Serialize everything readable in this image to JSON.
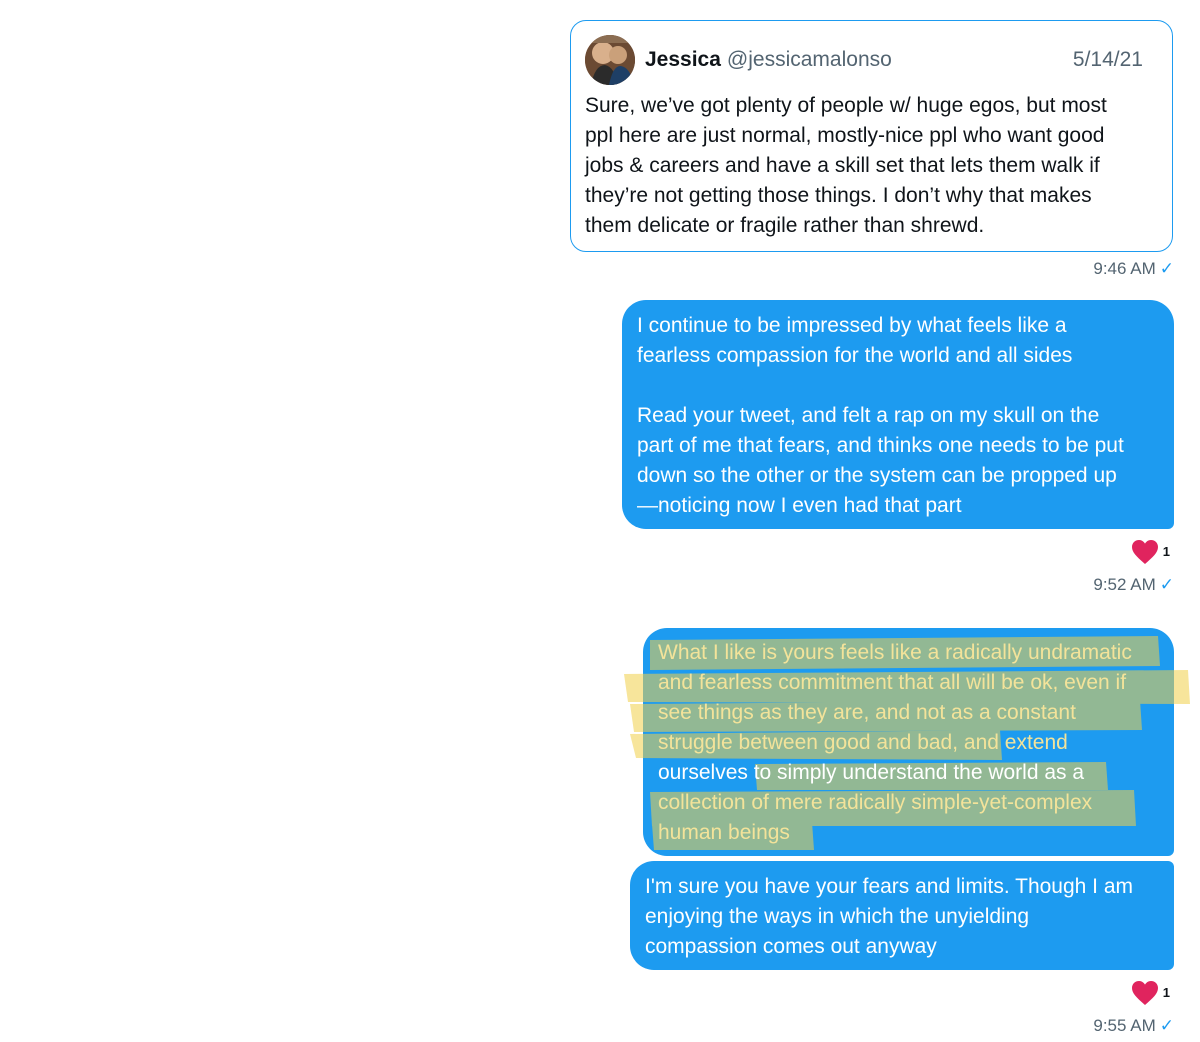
{
  "tweet": {
    "author_name": "Jessica",
    "author_handle": "@jessicamalonso",
    "date": "5/14/21",
    "lines": [
      "Sure, we’ve got plenty of people w/ huge egos, but most",
      "ppl here are just normal, mostly-nice ppl who want good",
      "jobs & careers and have a skill set that lets them walk if",
      "they’re not getting those things. I don’t why that makes",
      "them delicate or fragile rather than shrewd."
    ]
  },
  "timestamps": {
    "t1": "9:46 AM",
    "t2": "9:52 AM",
    "t3": "9:55 AM",
    "check": "✓"
  },
  "messages": {
    "m1": {
      "para1": [
        "I continue to be impressed by what feels like a",
        "fearless compassion for the world and all sides"
      ],
      "para2": [
        "Read your tweet, and felt a rap on my skull on the",
        "part of me that fears, and thinks one needs to be put",
        "down so the other or the system can be propped up",
        "—noticing now I even had that part"
      ]
    },
    "m2": {
      "lines": [
        "What I like is yours feels like a radically undramatic",
        "and fearless commitment that all will be ok, even if",
        "see things as they are, and not as a constant",
        "struggle between good and bad, and extend",
        "ourselves to simply understand the world as a",
        "collection of mere radically simple-yet-complex",
        "human beings"
      ]
    },
    "m3": {
      "lines": [
        "I'm sure you have your fears and limits. Though I am",
        "enjoying the ways in which the unyielding",
        "compassion comes out anyway"
      ]
    }
  },
  "reactions": {
    "r1": {
      "icon": "heart-icon",
      "count": "1",
      "color": "#e0245e"
    },
    "r2": {
      "icon": "heart-icon",
      "count": "1",
      "color": "#e0245e"
    }
  },
  "colors": {
    "bubble": "#1d9bf0",
    "highlighter": "#f2d04a",
    "secondary_text": "#536471"
  }
}
